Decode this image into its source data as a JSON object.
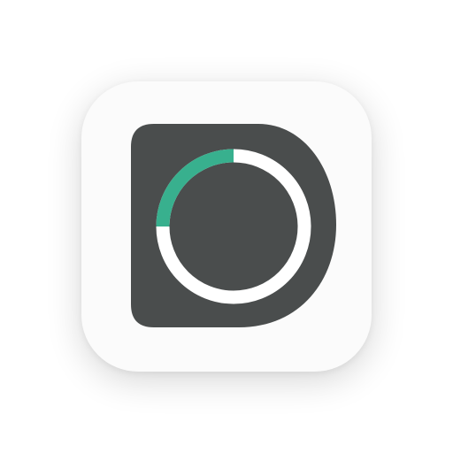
{
  "app": {
    "icon_name": "d-ring-app-icon",
    "progress_fraction": 0.25
  },
  "colors": {
    "background": "#ffffff",
    "tile": "#fbfbfb",
    "logo_body": "#4a4d4d",
    "ring_track": "#ffffff",
    "ring_progress": "#38b08e"
  }
}
